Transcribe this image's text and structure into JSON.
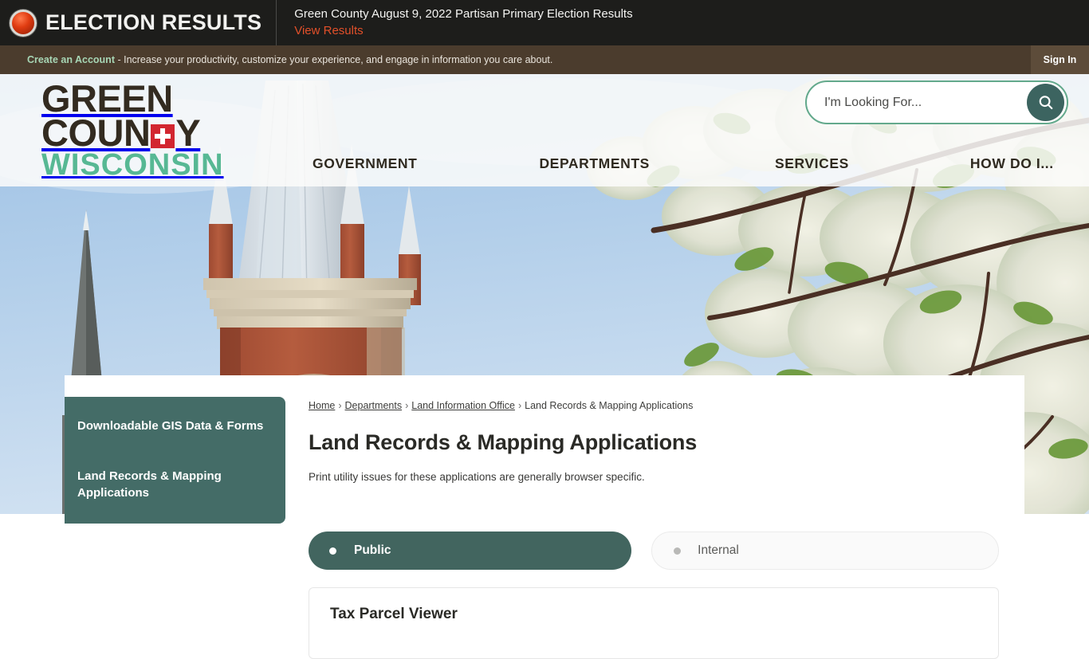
{
  "alert": {
    "brand_label": "ELECTION RESULTS",
    "icon": "red-circle-icon",
    "title": "Green County August 9, 2022 Partisan Primary Election Results",
    "link_label": "View Results"
  },
  "account_bar": {
    "link_label": "Create an Account",
    "message": " - Increase your productivity, customize your experience, and engage in information you care about.",
    "sign_in_label": "Sign In"
  },
  "logo": {
    "line1": "GREEN",
    "line2_a": "COUN",
    "line2_b": "Y",
    "line3": "WISCONSIN",
    "flag": "swiss-flag-icon"
  },
  "search": {
    "placeholder": "I'm Looking For...",
    "value": "",
    "button_icon": "search-icon"
  },
  "nav": {
    "items": [
      {
        "label": "GOVERNMENT"
      },
      {
        "label": "DEPARTMENTS"
      },
      {
        "label": "SERVICES"
      },
      {
        "label": "HOW DO I..."
      }
    ]
  },
  "hero": {
    "alt": "Green County courthouse clock tower with blossoming tree branches against a blue sky"
  },
  "sidebar": {
    "items": [
      {
        "label": "Downloadable GIS Data & Forms"
      },
      {
        "label": "Land Records & Mapping Applications"
      }
    ]
  },
  "breadcrumb": {
    "items": [
      {
        "label": "Home",
        "link": true
      },
      {
        "label": "Departments",
        "link": true
      },
      {
        "label": "Land Information Office",
        "link": true
      },
      {
        "label": "Land Records & Mapping Applications",
        "link": false
      }
    ],
    "separator": "›"
  },
  "main": {
    "title": "Land Records & Mapping Applications",
    "intro": "Print utility issues for these applications are generally browser specific.",
    "tabs": [
      {
        "label": "Public",
        "selected": true
      },
      {
        "label": "Internal",
        "selected": false
      }
    ],
    "panel_title": "Tax Parcel Viewer"
  },
  "colors": {
    "teal": "#42655f",
    "sidebar_teal": "#446c67",
    "brand_green": "#57b894",
    "alert_bg": "#1d1d1b",
    "alert_link": "#e2502a",
    "account_bg": "#4b3c2d",
    "account_link": "#a7d6b5",
    "swiss_red": "#d22630"
  }
}
